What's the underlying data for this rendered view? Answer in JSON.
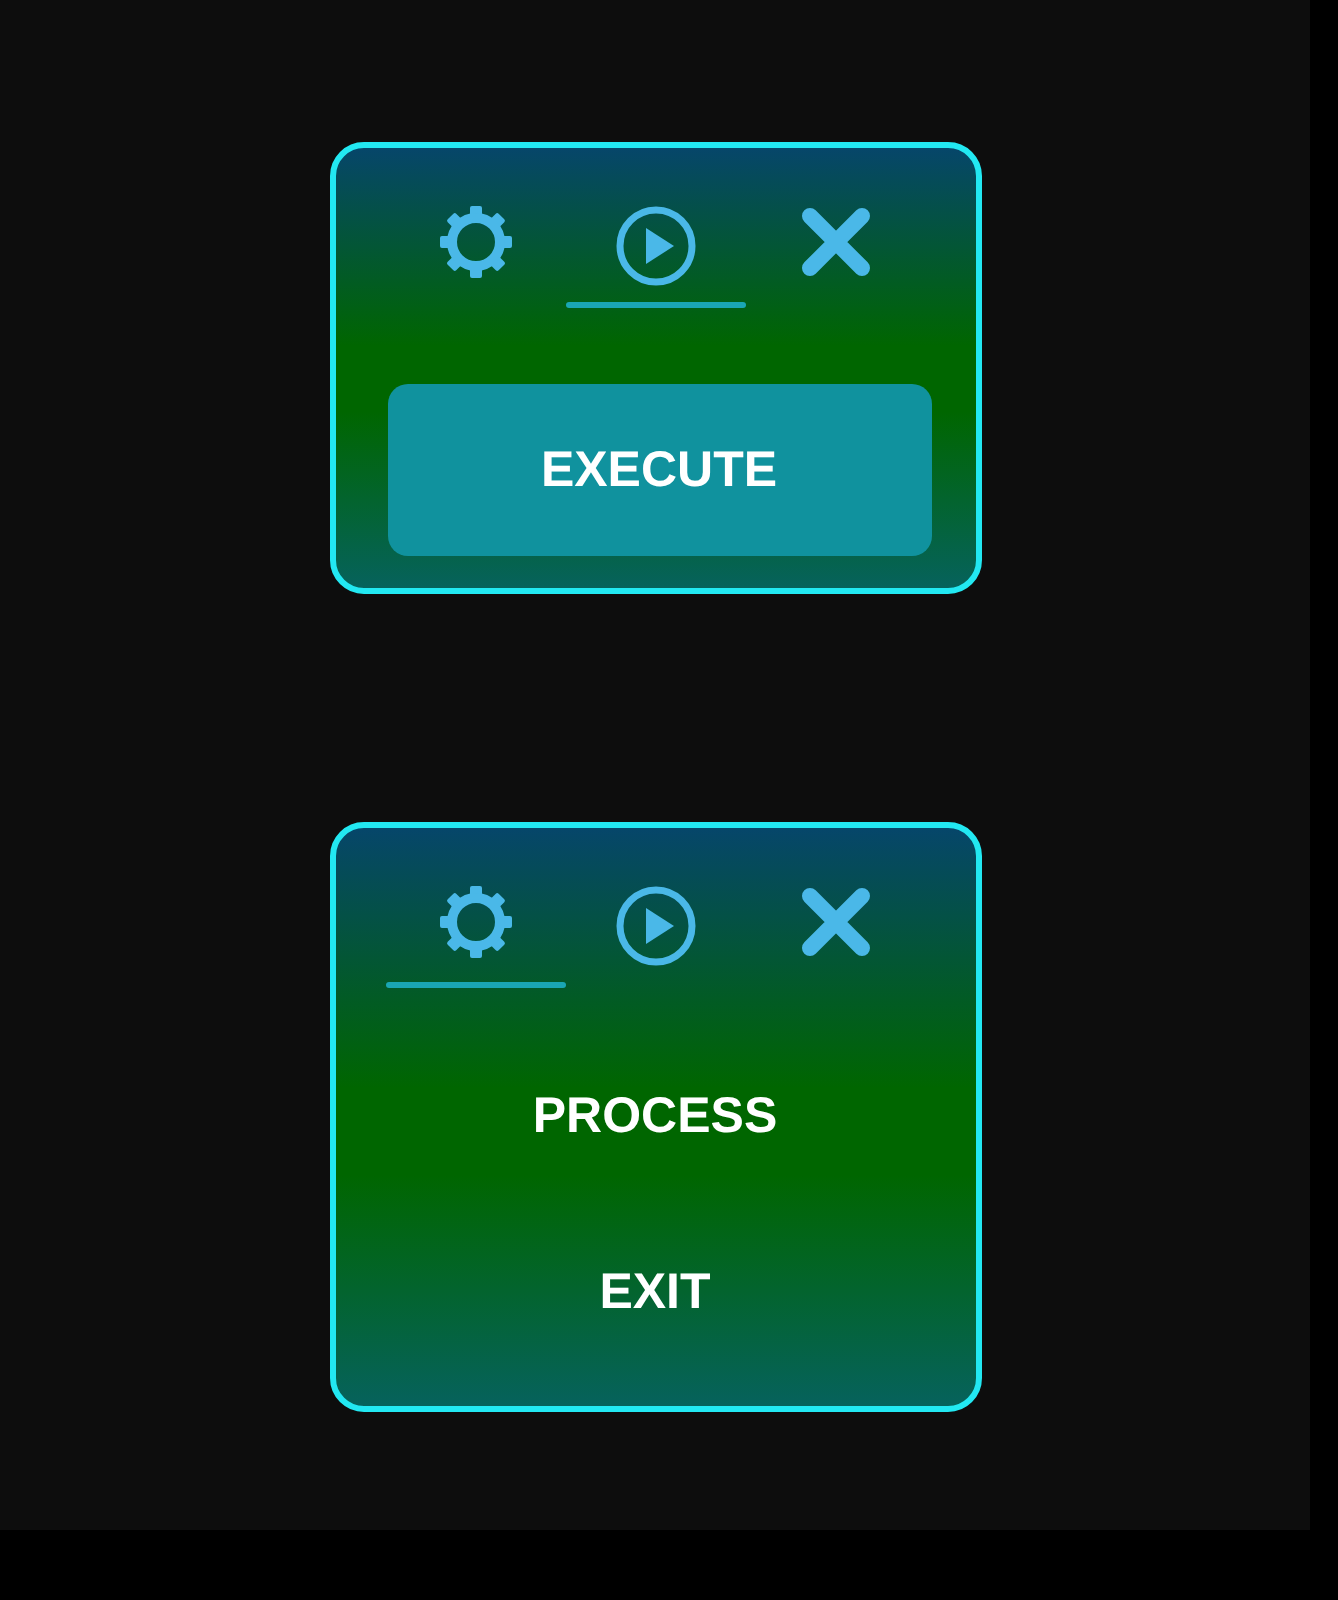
{
  "panels": [
    {
      "tabs": [
        {
          "kind": "gear",
          "selected": false
        },
        {
          "kind": "play",
          "selected": true
        },
        {
          "kind": "close",
          "selected": false
        }
      ],
      "items": [
        {
          "kind": "button",
          "label": "EXECUTE"
        }
      ]
    },
    {
      "tabs": [
        {
          "kind": "gear",
          "selected": true
        },
        {
          "kind": "play",
          "selected": false
        },
        {
          "kind": "close",
          "selected": false
        }
      ],
      "items": [
        {
          "kind": "menu-item",
          "label": "PROCESS"
        },
        {
          "kind": "menu-item",
          "label": "EXIT"
        }
      ]
    }
  ]
}
